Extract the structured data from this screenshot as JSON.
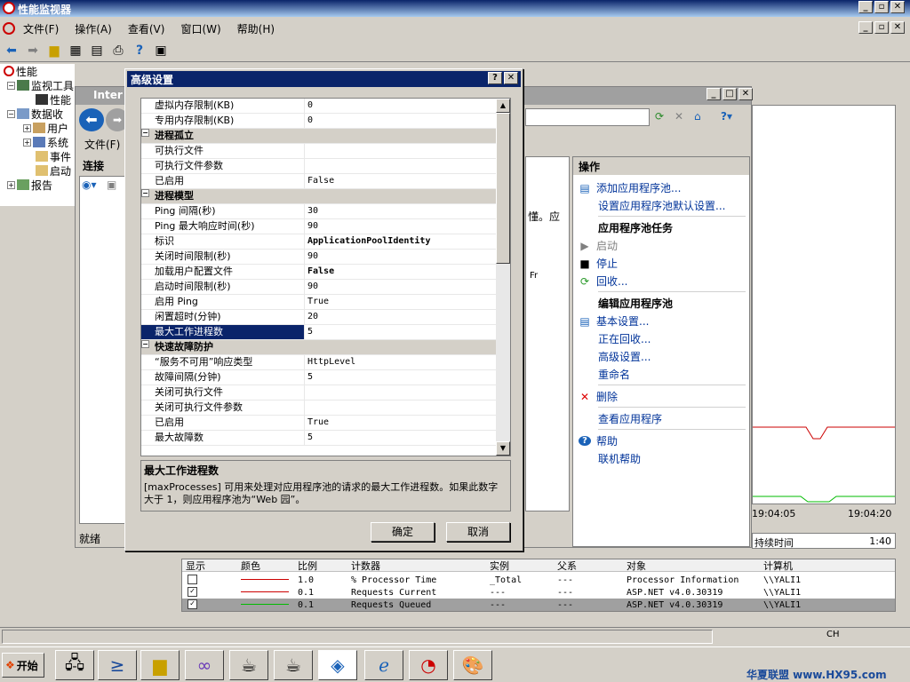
{
  "app": {
    "title": "性能监视器"
  },
  "menu": [
    "文件(F)",
    "操作(A)",
    "查看(V)",
    "窗口(W)",
    "帮助(H)"
  ],
  "tree": {
    "root": "性能",
    "items": [
      "监视工具",
      "性能",
      "数据收",
      "用户",
      "系统",
      "事件",
      "启动",
      "报告"
    ]
  },
  "iis": {
    "title": "Inter",
    "menu_file": "文件(F)",
    "connections_header": "连接",
    "status": "就绪",
    "peek_text": "懂。应",
    "col_short": "Fr"
  },
  "dialog": {
    "title": "高级设置",
    "help_btn": "?",
    "close_btn": "✕",
    "rows": [
      {
        "type": "prop",
        "key": "虚拟内存限制(KB)",
        "value": "0"
      },
      {
        "type": "prop",
        "key": "专用内存限制(KB)",
        "value": "0"
      },
      {
        "type": "cat",
        "key": "进程孤立"
      },
      {
        "type": "prop",
        "key": "可执行文件",
        "value": ""
      },
      {
        "type": "prop",
        "key": "可执行文件参数",
        "value": ""
      },
      {
        "type": "prop",
        "key": "已启用",
        "value": "False"
      },
      {
        "type": "cat",
        "key": "进程模型"
      },
      {
        "type": "prop",
        "key": "Ping 间隔(秒)",
        "value": "30"
      },
      {
        "type": "prop",
        "key": "Ping 最大响应时间(秒)",
        "value": "90"
      },
      {
        "type": "prop",
        "key": "标识",
        "value": "ApplicationPoolIdentity",
        "bold": true
      },
      {
        "type": "prop",
        "key": "关闭时间限制(秒)",
        "value": "90"
      },
      {
        "type": "prop",
        "key": "加载用户配置文件",
        "value": "False",
        "bold": true
      },
      {
        "type": "prop",
        "key": "启动时间限制(秒)",
        "value": "90"
      },
      {
        "type": "prop",
        "key": "启用 Ping",
        "value": "True"
      },
      {
        "type": "prop",
        "key": "闲置超时(分钟)",
        "value": "20"
      },
      {
        "type": "prop",
        "key": "最大工作进程数",
        "value": "5",
        "selected": true
      },
      {
        "type": "cat",
        "key": "快速故障防护"
      },
      {
        "type": "prop",
        "key": "“服务不可用”响应类型",
        "value": "HttpLevel"
      },
      {
        "type": "prop",
        "key": "故障间隔(分钟)",
        "value": "5"
      },
      {
        "type": "prop",
        "key": "关闭可执行文件",
        "value": ""
      },
      {
        "type": "prop",
        "key": "关闭可执行文件参数",
        "value": ""
      },
      {
        "type": "prop",
        "key": "已启用",
        "value": "True"
      },
      {
        "type": "prop",
        "key": "最大故障数",
        "value": "5"
      }
    ],
    "desc_title": "最大工作进程数",
    "desc_text": "[maxProcesses] 可用来处理对应用程序池的请求的最大工作进程数。如果此数字大于 1，则应用程序池为“Web 园”。",
    "ok": "确定",
    "cancel": "取消"
  },
  "actions": {
    "header": "操作",
    "items": [
      {
        "label": "添加应用程序池...",
        "icon": "add-pool-icon",
        "kind": "link"
      },
      {
        "label": "设置应用程序池默认设置...",
        "icon": "",
        "kind": "link"
      },
      {
        "label": "应用程序池任务",
        "icon": "",
        "kind": "heading"
      },
      {
        "label": "启动",
        "icon": "play-icon",
        "kind": "disabled"
      },
      {
        "label": "停止",
        "icon": "stop-icon",
        "kind": "link"
      },
      {
        "label": "回收...",
        "icon": "recycle-icon",
        "kind": "link"
      },
      {
        "label": "编辑应用程序池",
        "icon": "",
        "kind": "heading"
      },
      {
        "label": "基本设置...",
        "icon": "settings-icon",
        "kind": "link"
      },
      {
        "label": "正在回收...",
        "icon": "",
        "kind": "link"
      },
      {
        "label": "高级设置...",
        "icon": "",
        "kind": "link"
      },
      {
        "label": "重命名",
        "icon": "",
        "kind": "link"
      },
      {
        "label": "删除",
        "icon": "delete-icon",
        "kind": "link"
      },
      {
        "label": "查看应用程序",
        "icon": "",
        "kind": "link"
      },
      {
        "label": "帮助",
        "icon": "help-icon",
        "kind": "link"
      },
      {
        "label": "联机帮助",
        "icon": "",
        "kind": "link"
      }
    ]
  },
  "graph": {
    "time_start": "19:04:05",
    "time_end": "19:04:20",
    "duration_label": "持续时间",
    "duration_value": "1:40",
    "colors": {
      "red": "#cc0000",
      "green": "#00bb00"
    }
  },
  "counters": {
    "headers": [
      "显示",
      "颜色",
      "比例",
      "计数器",
      "实例",
      "父系",
      "对象",
      "计算机"
    ],
    "rows": [
      {
        "checked": false,
        "color": "#cc0000",
        "scale": "1.0",
        "counter": "% Processor Time",
        "instance": "_Total",
        "parent": "---",
        "object": "Processor Information",
        "computer": "\\\\YALI1"
      },
      {
        "checked": true,
        "color": "#cc0000",
        "scale": "0.1",
        "counter": "Requests Current",
        "instance": "---",
        "parent": "---",
        "object": "ASP.NET v4.0.30319",
        "computer": "\\\\YALI1"
      },
      {
        "checked": true,
        "color": "#00bb00",
        "scale": "0.1",
        "counter": "Requests Queued",
        "instance": "---",
        "parent": "---",
        "object": "ASP.NET v4.0.30319",
        "computer": "\\\\YALI1",
        "selected": true
      }
    ]
  },
  "taskbar": {
    "start": "开始",
    "lang": "CH"
  },
  "watermark": "华夏联盟 www.HX95.com"
}
